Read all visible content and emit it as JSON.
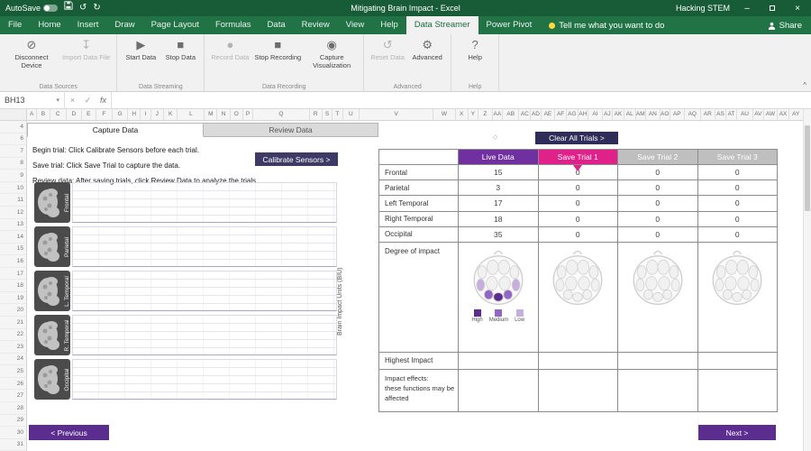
{
  "window": {
    "autosave_label": "AutoSave",
    "title": "Mitigating Brain Impact - Excel",
    "user": "Hacking STEM"
  },
  "ribbon": {
    "tabs": [
      "File",
      "Home",
      "Insert",
      "Draw",
      "Page Layout",
      "Formulas",
      "Data",
      "Review",
      "View",
      "Help",
      "Data Streamer",
      "Power Pivot"
    ],
    "active_tab": "Data Streamer",
    "tell_me": "Tell me what you want to do",
    "share": "Share",
    "groups": [
      {
        "name": "Data Sources",
        "buttons": [
          {
            "label": "Disconnect Device",
            "icon": "disconnect-icon",
            "enabled": true
          },
          {
            "label": "Import Data File",
            "icon": "import-file-icon",
            "enabled": false
          }
        ]
      },
      {
        "name": "Data Streaming",
        "buttons": [
          {
            "label": "Start Data",
            "icon": "play-icon",
            "enabled": true
          },
          {
            "label": "Stop Data",
            "icon": "stop-icon",
            "enabled": true
          }
        ]
      },
      {
        "name": "Data Recording",
        "buttons": [
          {
            "label": "Record Data",
            "icon": "record-icon",
            "enabled": false
          },
          {
            "label": "Stop Recording",
            "icon": "stop-recording-icon",
            "enabled": true
          },
          {
            "label": "Capture Visualization",
            "icon": "camera-icon",
            "enabled": true
          }
        ]
      },
      {
        "name": "Advanced",
        "buttons": [
          {
            "label": "Reset Data",
            "icon": "reset-icon",
            "enabled": false
          },
          {
            "label": "Advanced",
            "icon": "gear-icon",
            "enabled": true
          }
        ]
      },
      {
        "name": "Help",
        "buttons": [
          {
            "label": "Help",
            "icon": "help-icon",
            "enabled": true
          }
        ]
      }
    ]
  },
  "formula_bar": {
    "name_box": "BH13",
    "cancel": "×",
    "enter": "✓",
    "fx": "fx"
  },
  "grid": {
    "columns": [
      "A",
      "B",
      "C",
      "D",
      "E",
      "F",
      "G",
      "H",
      "I",
      "J",
      "K",
      "L",
      "M",
      "N",
      "O",
      "P",
      "Q",
      "R",
      "S",
      "T",
      "U",
      "V",
      "W",
      "X",
      "Y",
      "Z",
      "AA",
      "AB",
      "AC",
      "AD",
      "AE",
      "AF",
      "AG",
      "AH",
      "AI",
      "AJ",
      "AK",
      "AL",
      "AM",
      "AN",
      "AO",
      "AP",
      "AQ",
      "AR",
      "AS",
      "AT",
      "AU",
      "AV",
      "AW",
      "AX",
      "AY"
    ],
    "rows": [
      "4",
      "6",
      "7",
      "8",
      "9",
      "10",
      "11",
      "12",
      "13",
      "14",
      "15",
      "16",
      "17",
      "18",
      "19",
      "20",
      "21",
      "22",
      "23",
      "24",
      "25",
      "26",
      "27",
      "28",
      "29",
      "30",
      "31"
    ]
  },
  "sheet": {
    "tabs": {
      "capture": "Capture Data",
      "review": "Review Data"
    },
    "instructions": [
      "Begin trial: Click Calibrate Sensors before each trial.",
      "Save trial: Click Save Trial to capture the data.",
      "Review data: After saving trials, click Review Data to analyze the trials."
    ],
    "calibrate_button": "Calibrate Sensors >",
    "clear_button": "Clear All Trials >",
    "y_axis_label": "Brain Impact Units (BIU)",
    "charts": [
      {
        "label": "Frontal"
      },
      {
        "label": "Parietal"
      },
      {
        "label": "L. Temporal"
      },
      {
        "label": "R. Temporal"
      },
      {
        "label": "Occipital"
      }
    ],
    "table": {
      "headers": [
        "Live Data",
        "Save Trial 1",
        "Save Trial 2",
        "Save Trial 3"
      ],
      "rows": [
        {
          "label": "Frontal",
          "values": [
            "15",
            "0",
            "0",
            "0"
          ]
        },
        {
          "label": "Parietal",
          "values": [
            "3",
            "0",
            "0",
            "0"
          ]
        },
        {
          "label": "Left Temporal",
          "values": [
            "17",
            "0",
            "0",
            "0"
          ]
        },
        {
          "label": "Right Temporal",
          "values": [
            "18",
            "0",
            "0",
            "0"
          ]
        },
        {
          "label": "Occipital",
          "values": [
            "35",
            "0",
            "0",
            "0"
          ]
        }
      ],
      "degree_label": "Degree of impact",
      "legend": [
        {
          "label": "High",
          "color": "#5b2d8e"
        },
        {
          "label": "Medium",
          "color": "#9166c4"
        },
        {
          "label": "Low",
          "color": "#c6aede"
        }
      ],
      "highest_label": "Highest Impact",
      "effects_lines": [
        "Impact effects:",
        "these functions may be",
        "affected"
      ]
    },
    "prev_button": "< Previous",
    "next_button": "Next >"
  },
  "colors": {
    "titlebar": "#185c37",
    "ribbon_green": "#217346",
    "live": "#7030a0",
    "trial1": "#e0218a",
    "trial_gray": "#bfbfbf",
    "calibrate": "#3e3a66",
    "clear": "#2e2c58",
    "nav": "#5b2d8e"
  }
}
